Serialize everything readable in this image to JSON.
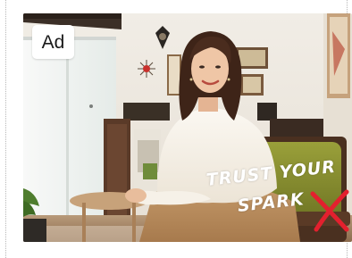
{
  "ad": {
    "badge_label": "Ad",
    "tagline_line1": "TRUST YOUR",
    "tagline_line2": "SPARK",
    "accent_color": "#e3202e"
  }
}
